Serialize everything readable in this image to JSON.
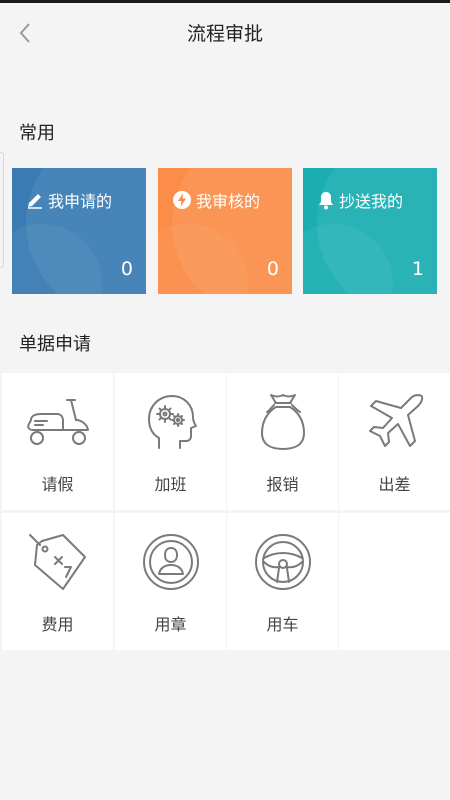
{
  "header": {
    "title": "流程审批",
    "back_icon": "chevron-left-icon"
  },
  "common": {
    "section_title": "常用",
    "cards": [
      {
        "label": "我申请的",
        "count": "0",
        "icon": "pencil-icon",
        "color": "#3a7bb3"
      },
      {
        "label": "我审核的",
        "count": "0",
        "icon": "lightning-icon",
        "color": "#fb8d49"
      },
      {
        "label": "抄送我的",
        "count": "1",
        "icon": "bell-icon",
        "color": "#1aaeb2"
      }
    ]
  },
  "forms": {
    "section_title": "单据申请",
    "items": [
      {
        "label": "请假",
        "icon": "scooter-icon"
      },
      {
        "label": "加班",
        "icon": "head-gears-icon"
      },
      {
        "label": "报销",
        "icon": "money-bag-icon"
      },
      {
        "label": "出差",
        "icon": "airplane-icon"
      },
      {
        "label": "费用",
        "icon": "price-tag-icon"
      },
      {
        "label": "用章",
        "icon": "stamp-user-icon"
      },
      {
        "label": "用车",
        "icon": "steering-wheel-icon"
      }
    ]
  }
}
